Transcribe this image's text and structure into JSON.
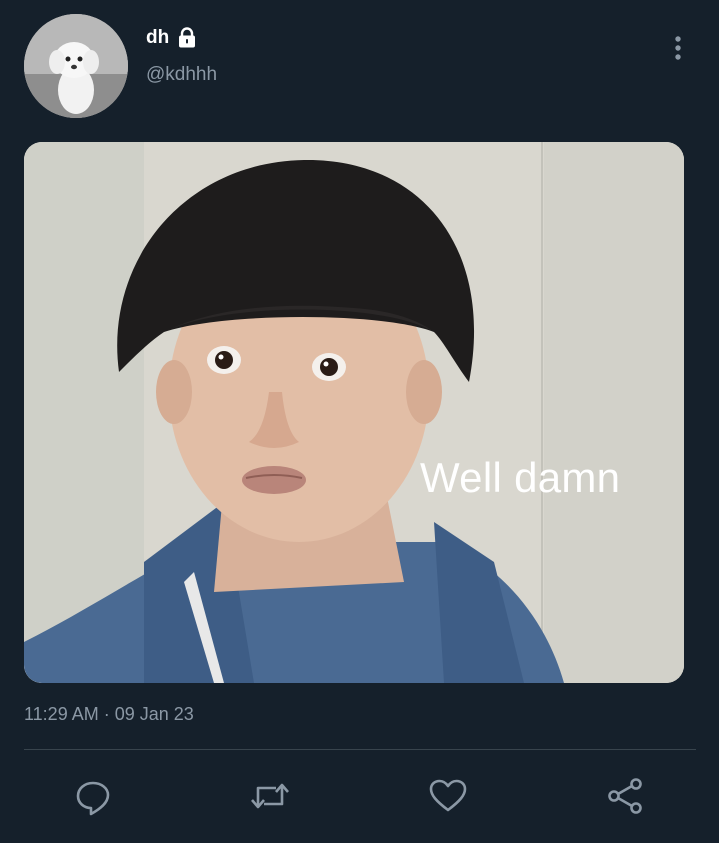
{
  "user": {
    "display_name": "dh",
    "handle": "@kdhhh",
    "protected": true
  },
  "tweet": {
    "image_caption": "Well damn",
    "timestamp": "11:29 AM · 09 Jan 23"
  },
  "icons": {
    "lock": "lock-icon",
    "more": "more-vertical-icon",
    "reply": "reply-icon",
    "retweet": "retweet-icon",
    "like": "heart-icon",
    "share": "share-icon"
  },
  "colors": {
    "background": "#15202b",
    "secondary_text": "#8b98a5",
    "divider": "#38444d"
  }
}
